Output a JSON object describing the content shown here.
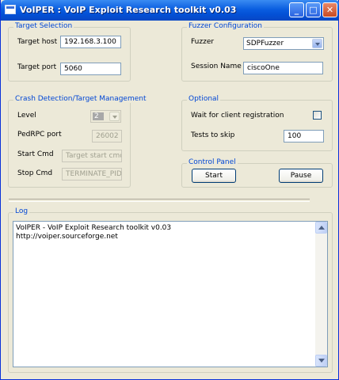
{
  "window": {
    "title": "VoIPER : VoIP Exploit Research toolkit v0.03"
  },
  "title_buttons": {
    "minimize": "_",
    "maximize": "□",
    "close": "✕"
  },
  "target": {
    "title": "Target Selection",
    "host_label": "Target host",
    "host_value": "192.168.3.100",
    "port_label": "Target port",
    "port_value": "5060"
  },
  "fuzzer": {
    "title": "Fuzzer Configuration",
    "fuzzer_label": "Fuzzer",
    "fuzzer_value": "SDPFuzzer",
    "session_label": "Session Name",
    "session_value": "ciscoOne"
  },
  "crash": {
    "title": "Crash Detection/Target Management",
    "level_label": "Level",
    "level_value": "2",
    "pedrpc_label": "PedRPC port",
    "pedrpc_value": "26002",
    "start_label": "Start Cmd",
    "start_placeholder": "Target start cmd",
    "stop_label": "Stop Cmd",
    "stop_value": "TERMINATE_PID"
  },
  "optional": {
    "title": "Optional",
    "wait_label": "Wait for client registration",
    "wait_checked": false,
    "skip_label": "Tests to skip",
    "skip_value": "100"
  },
  "control": {
    "title": "Control Panel",
    "start_label": "Start",
    "pause_label": "Pause"
  },
  "log": {
    "title": "Log",
    "lines": [
      "VoIPER - VoIP Exploit Research toolkit v0.03",
      "http://voiper.sourceforge.net"
    ]
  }
}
